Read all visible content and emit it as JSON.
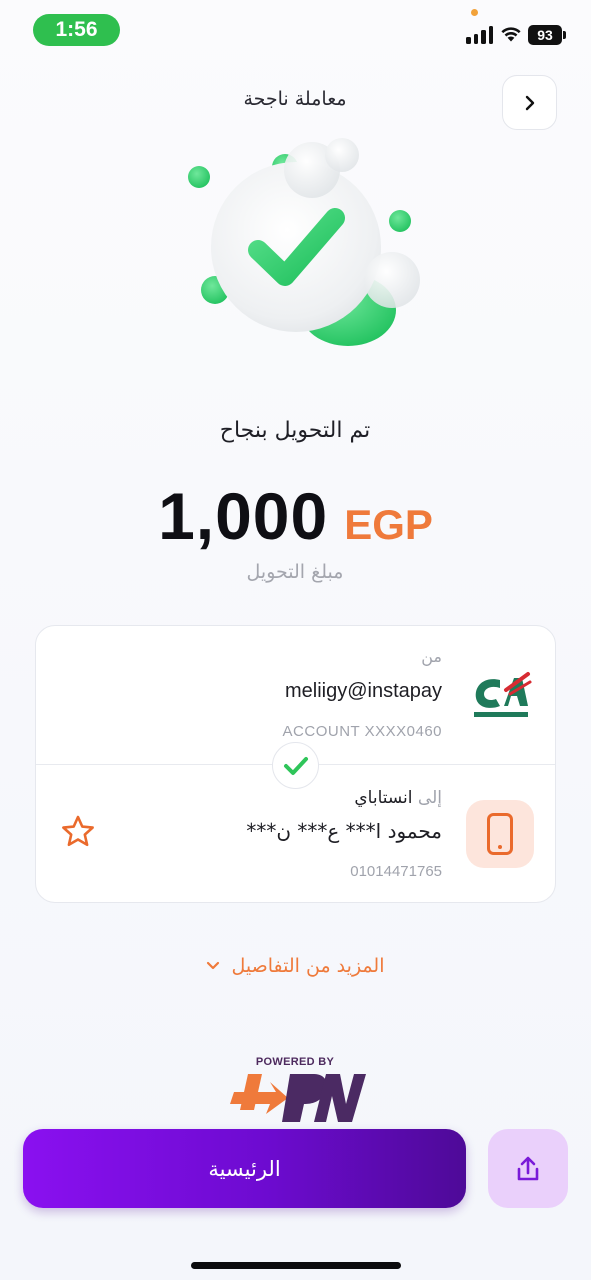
{
  "status_bar": {
    "time": "1:56",
    "battery": "93"
  },
  "header": {
    "title": "معاملة ناجحة",
    "back_icon": "chevron-right-icon"
  },
  "hero": {
    "icon": "success-check-illustration",
    "colors": {
      "green": "#2ecc6b",
      "orb": "#ffffff"
    }
  },
  "result": {
    "message": "تم التحويل بنجاح",
    "amount": "1,000",
    "currency": "EGP",
    "amount_label": "مبلغ التحويل"
  },
  "transfer": {
    "from": {
      "label": "من",
      "handle": "meliigy@instapay",
      "account": "ACCOUNT  XXXX0460",
      "bank_icon": "credit-agricole-logo"
    },
    "to": {
      "label_prefix": "إلى",
      "label_channel": "انستاباي",
      "name": "محمود ا*** ع*** ن***",
      "phone": "01014471765",
      "icon": "mobile-phone-icon",
      "favorite_icon": "star-outline-icon"
    }
  },
  "more_details": "المزيد من التفاصيل",
  "footer": {
    "powered_by": "POWERED BY",
    "home_button": "الرئيسية",
    "share_icon": "share-icon"
  },
  "theme": {
    "accent_orange": "#ef7a3b",
    "primary_purple": "#7a0ee0",
    "success_green": "#2fbf4f"
  }
}
